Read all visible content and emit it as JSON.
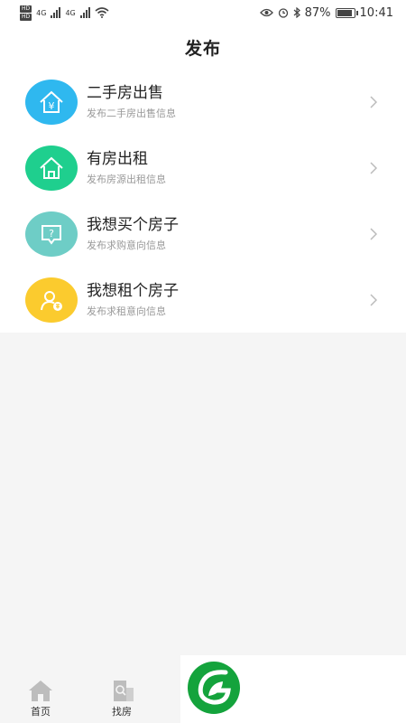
{
  "status_bar": {
    "hd1": "HD",
    "hd2": "HD",
    "net1": "4G",
    "net2": "4G",
    "battery": "87%",
    "time": "10:41"
  },
  "header": {
    "title": "发布"
  },
  "items": [
    {
      "title": "二手房出售",
      "subtitle": "发布二手房出售信息",
      "color": "#2fb8ef",
      "icon": "house-yen-icon"
    },
    {
      "title": "有房出租",
      "subtitle": "发布房源出租信息",
      "color": "#1fcf8e",
      "icon": "house-icon"
    },
    {
      "title": "我想买个房子",
      "subtitle": "发布求购意向信息",
      "color": "#6ecdc6",
      "icon": "question-bubble-icon"
    },
    {
      "title": "我想租个房子",
      "subtitle": "发布求租意向信息",
      "color": "#fbcb2e",
      "icon": "person-rent-icon"
    }
  ],
  "tabs": [
    {
      "label": "首页",
      "icon": "home-icon"
    },
    {
      "label": "找房",
      "icon": "building-search-icon"
    }
  ],
  "logo_color": "#14a33c"
}
